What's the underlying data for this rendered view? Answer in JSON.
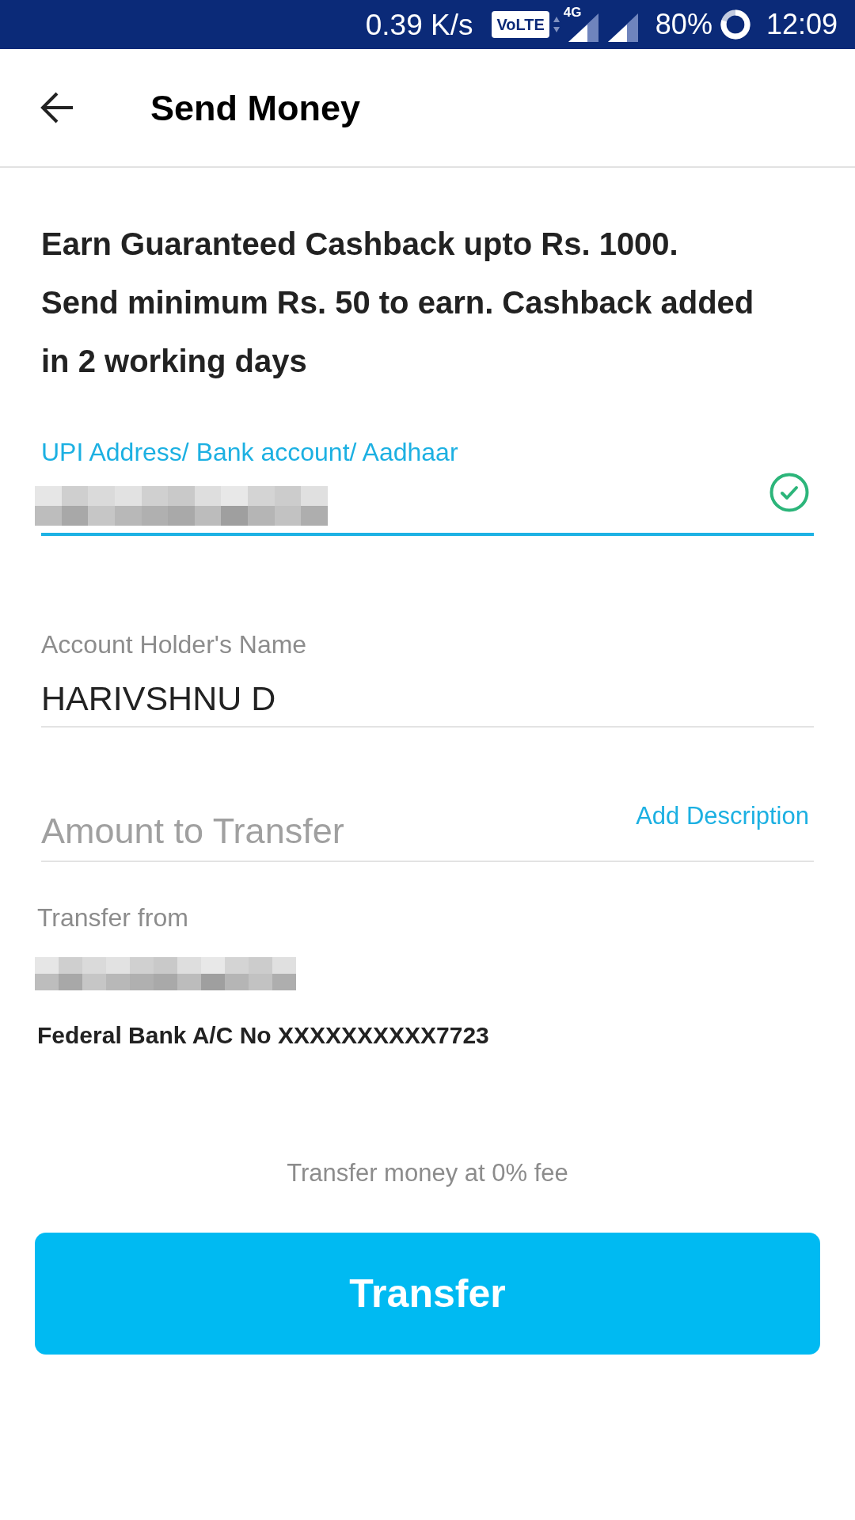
{
  "status_bar": {
    "network_speed": "0.39 K/s",
    "volte_badge": "VoLTE",
    "network_type": "4G",
    "battery": "80%",
    "time": "12:09"
  },
  "header": {
    "title": "Send Money"
  },
  "promo": {
    "text": "Earn Guaranteed Cashback upto Rs. 1000.\nSend minimum Rs. 50 to earn. Cashback added in 2 working days"
  },
  "form": {
    "fields": [
      {
        "kind": "recipient",
        "label": "UPI Address/ Bank account/ Aadhaar",
        "focused": true,
        "redacted": true,
        "verified": true
      },
      {
        "kind": "text",
        "label": "Account Holder's Name",
        "value": "HARIVSHNU D",
        "focused": false
      },
      {
        "kind": "amount",
        "placeholder": "Amount to Transfer",
        "action": "Add Description",
        "focused": false
      }
    ]
  },
  "transfer_from": {
    "label": "Transfer from",
    "redacted": true,
    "account": "Federal Bank A/C No XXXXXXXXXX7723"
  },
  "fee_note": "Transfer money at 0% fee",
  "primary_button": {
    "label": "Transfer"
  }
}
